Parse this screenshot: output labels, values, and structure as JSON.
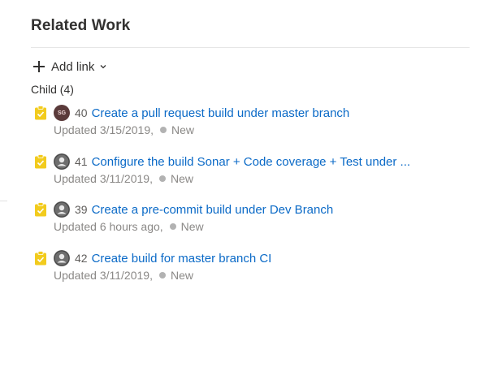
{
  "section": {
    "title": "Related Work",
    "add_link_label": "Add link"
  },
  "group": {
    "label": "Child (4)"
  },
  "items": [
    {
      "id": "40",
      "title": "Create a pull request build under master branch",
      "updated": "Updated 3/15/2019,",
      "state": "New",
      "avatar": "initials",
      "initials": "SG"
    },
    {
      "id": "41",
      "title": "Configure the build Sonar + Code coverage + Test under ...",
      "updated": "Updated 3/11/2019,",
      "state": "New",
      "avatar": "default"
    },
    {
      "id": "39",
      "title": "Create a pre-commit build under Dev Branch",
      "updated": "Updated 6 hours ago,",
      "state": "New",
      "avatar": "default"
    },
    {
      "id": "42",
      "title": "Create build for master branch CI",
      "updated": "Updated 3/11/2019,",
      "state": "New",
      "avatar": "default"
    }
  ],
  "icons": {
    "add": "plus-icon",
    "dropdown": "chevron-down-icon",
    "work_item_type": "task-clipboard-icon",
    "assignee": "avatar-icon",
    "state": "state-dot-icon"
  },
  "colors": {
    "link": "#0b6ac7",
    "task_icon": "#f2cb1d",
    "state_new": "#b2b2b2",
    "muted_text": "#8a8886"
  }
}
